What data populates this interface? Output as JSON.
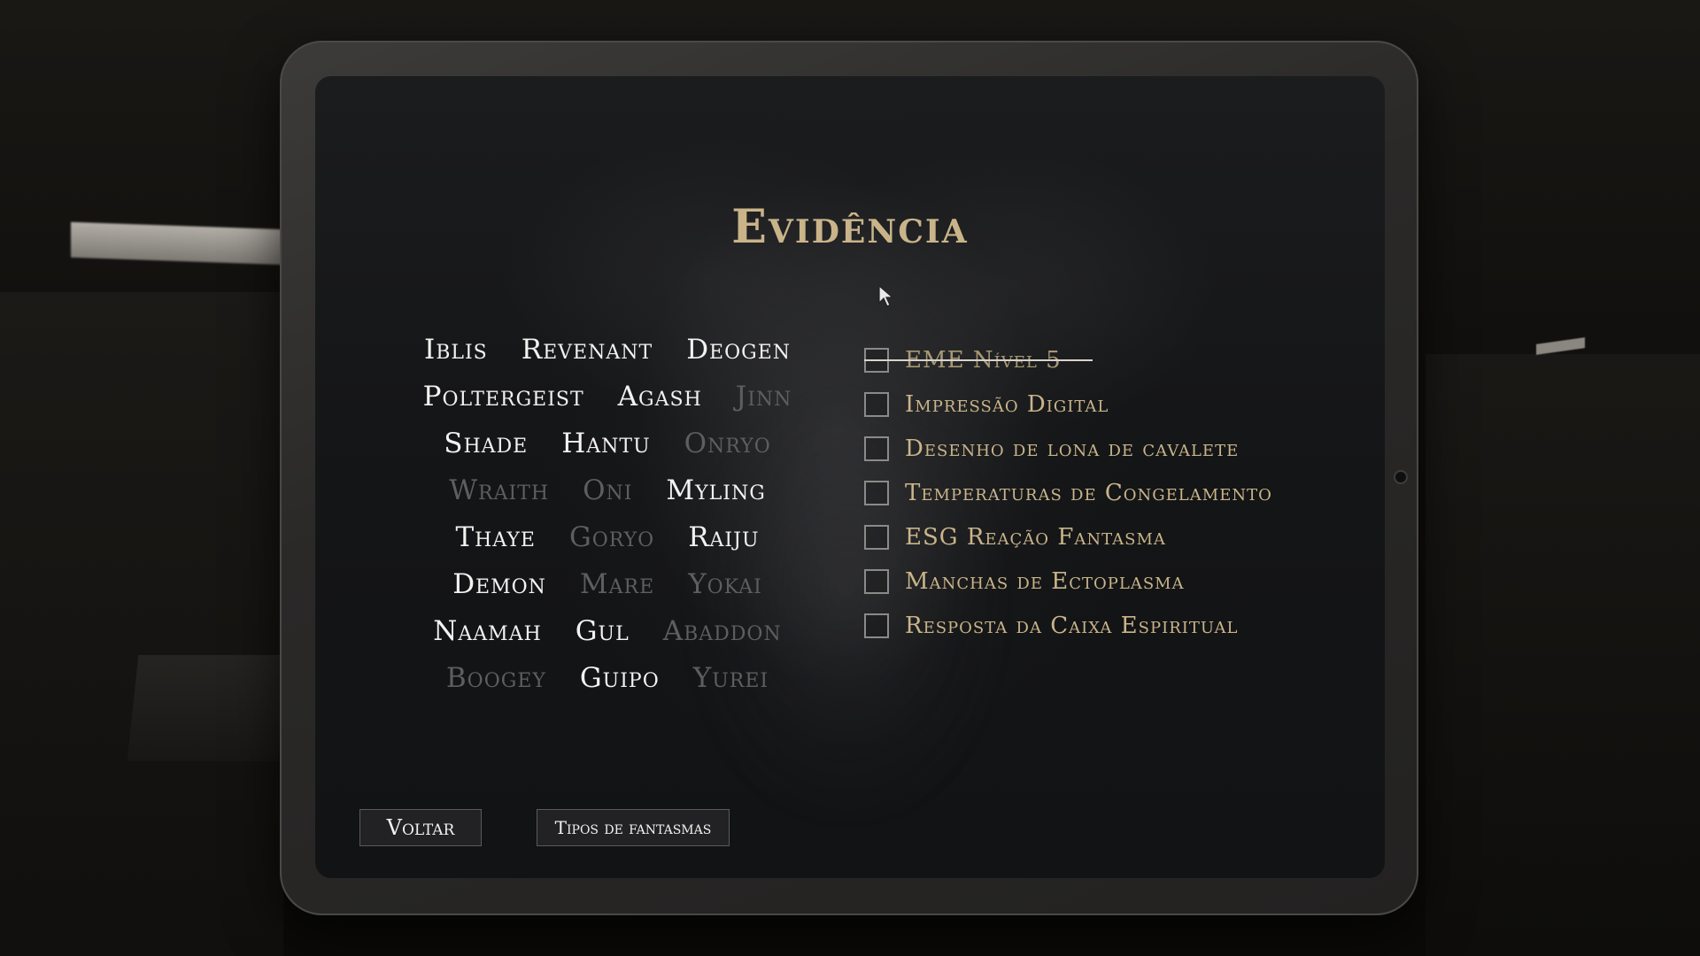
{
  "title": "Evidência",
  "ghosts": [
    [
      {
        "name": "Iblis",
        "active": true
      },
      {
        "name": "Revenant",
        "active": true
      },
      {
        "name": "Deogen",
        "active": true
      }
    ],
    [
      {
        "name": "Poltergeist",
        "active": true
      },
      {
        "name": "Agash",
        "active": true
      },
      {
        "name": "Jinn",
        "active": false
      }
    ],
    [
      {
        "name": "Shade",
        "active": true
      },
      {
        "name": "Hantu",
        "active": true
      },
      {
        "name": "Onryo",
        "active": false
      }
    ],
    [
      {
        "name": "Wraith",
        "active": false
      },
      {
        "name": "Oni",
        "active": false
      },
      {
        "name": "Myling",
        "active": true
      }
    ],
    [
      {
        "name": "Thaye",
        "active": true
      },
      {
        "name": "Goryo",
        "active": false
      },
      {
        "name": "Raiju",
        "active": true
      }
    ],
    [
      {
        "name": "Demon",
        "active": true
      },
      {
        "name": "Mare",
        "active": false
      },
      {
        "name": "Yokai",
        "active": false
      }
    ],
    [
      {
        "name": "Naamah",
        "active": true
      },
      {
        "name": "Gul",
        "active": true
      },
      {
        "name": "Abaddon",
        "active": false
      }
    ],
    [
      {
        "name": "Boogey",
        "active": false
      },
      {
        "name": "Guipo",
        "active": true
      },
      {
        "name": "Yurei",
        "active": false
      }
    ]
  ],
  "evidence": [
    {
      "label": "EME Nível 5",
      "checked": false,
      "struck": true
    },
    {
      "label": "Impressão Digital",
      "checked": false,
      "struck": false
    },
    {
      "label": "Desenho de lona de cavalete",
      "checked": false,
      "struck": false
    },
    {
      "label": "Temperaturas de Congelamento",
      "checked": false,
      "struck": false
    },
    {
      "label": "ESG Reação Fantasma",
      "checked": false,
      "struck": false
    },
    {
      "label": "Manchas de Ectoplasma",
      "checked": false,
      "struck": false
    },
    {
      "label": "Resposta da Caixa Espiritual",
      "checked": false,
      "struck": false
    }
  ],
  "buttons": {
    "back_label": "Voltar",
    "ghost_types_label": "Tipos de fantasmas"
  },
  "colors": {
    "accent_gold": "#c9b48a",
    "active_text": "#f2f2f0",
    "inactive_text": "#5d5e60"
  }
}
